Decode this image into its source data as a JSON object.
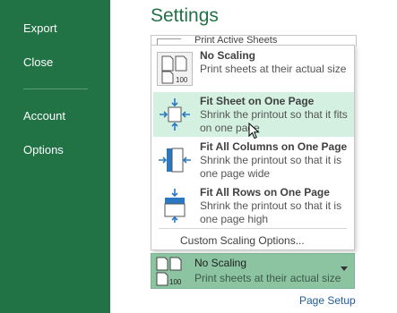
{
  "sidebar": {
    "items": [
      {
        "label": "Export"
      },
      {
        "label": "Close"
      },
      {
        "label": "Account"
      },
      {
        "label": "Options"
      }
    ]
  },
  "settings": {
    "title": "Settings",
    "behind_row_text": "Print Active Sheets"
  },
  "scaling_menu": {
    "options": [
      {
        "title": "No Scaling",
        "desc": "Print sheets at their actual size",
        "icon": "no-scaling-icon",
        "icon_label": "100"
      },
      {
        "title": "Fit Sheet on One Page",
        "desc": "Shrink the printout so that it fits on one page",
        "icon": "fit-sheet-icon"
      },
      {
        "title": "Fit All Columns on One Page",
        "desc": "Shrink the printout so that it is one page wide",
        "icon": "fit-columns-icon"
      },
      {
        "title": "Fit All Rows on One Page",
        "desc": "Shrink the printout so that it is one page high",
        "icon": "fit-rows-icon"
      }
    ],
    "custom_label": "Custom Scaling Options..."
  },
  "current_scaling": {
    "title": "No Scaling",
    "desc": "Print sheets at their actual size",
    "icon_label": "100"
  },
  "page_setup_link": "Page Setup",
  "colors": {
    "sidebar": "#217346",
    "title": "#217346",
    "selected_option": "#d3f0e0",
    "current_scaling_bg": "#8cc4a2",
    "link": "#1f5c99"
  }
}
